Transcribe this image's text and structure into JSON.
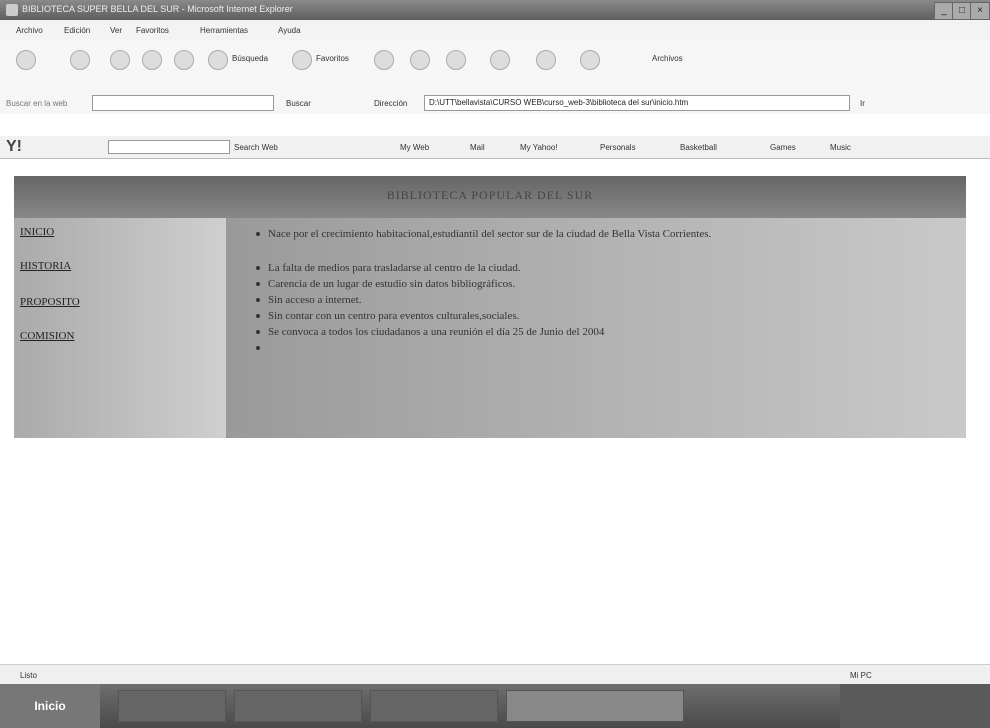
{
  "window": {
    "title": "BIBLIOTECA SUPER BELLA DEL SUR - Microsoft Internet Explorer",
    "minimize": "_",
    "maximize": "□",
    "close": "×"
  },
  "menu": [
    "Archivo",
    "Edición",
    "Ver",
    "Favoritos",
    "Herramientas",
    "Ayuda"
  ],
  "toolbar": {
    "search": "Búsqueda",
    "favorites": "Favoritos",
    "archives": "Archivos"
  },
  "address": {
    "search_label": "Buscar en la web",
    "buscar": "Buscar",
    "direccion": "Dirección",
    "url": "D:\\UTT\\bellavista\\CURSO WEB\\curso_web-3\\biblioteca del sur\\inicio.htm",
    "go": "Ir"
  },
  "yahoo": {
    "logo": "Y!",
    "search_web": "Search Web",
    "my_web": "My Web",
    "mail": "Mail",
    "my_yahoo": "My Yahoo!",
    "personals": "Personals",
    "basketball": "Basketball",
    "games": "Games",
    "music": "Music"
  },
  "page": {
    "header": "BIBLIOTECA POPULAR DEL SUR",
    "nav": [
      "INICIO",
      "HISTORIA",
      "PROPOSITO",
      "COMISION"
    ],
    "intro": "Nace por el crecimiento habitacional,estudiantil del sector sur de la ciudad de Bella Vista Corrientes.",
    "bullets": [
      "La falta de medios para trasladarse al centro de la ciudad.",
      "Carencia de un lugar de estudio sin datos bibliográficos.",
      "Sin acceso a internet.",
      "Sin contar con un centro para eventos culturales,sociales.",
      "Se convoca a todos los ciudadanos a una reunión el día 25 de Junio del 2004",
      ""
    ]
  },
  "status": {
    "text": "Listo",
    "zone": "Mi PC"
  },
  "taskbar": {
    "start": "Inicio",
    "clock": ""
  }
}
